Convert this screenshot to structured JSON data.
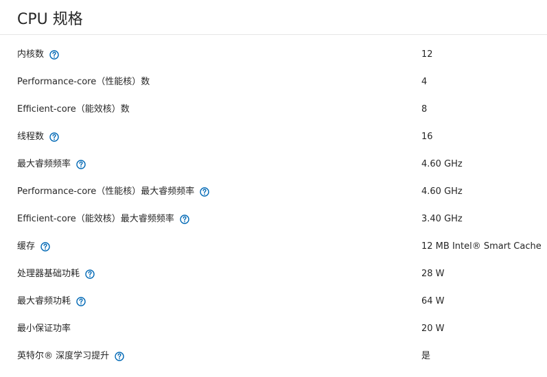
{
  "page": {
    "title": "CPU 规格"
  },
  "colors": {
    "text": "#262626",
    "divider": "#e5e5e5",
    "help_icon": "#0068b5"
  },
  "help_icon_name": "question-circle-icon",
  "specs": [
    {
      "label": "内核数",
      "value": "12",
      "has_help": true
    },
    {
      "label": "Performance-core（性能核）数",
      "value": "4",
      "has_help": false
    },
    {
      "label": "Efficient-core（能效核）数",
      "value": "8",
      "has_help": false
    },
    {
      "label": "线程数",
      "value": "16",
      "has_help": true
    },
    {
      "label": "最大睿频频率",
      "value": "4.60 GHz",
      "has_help": true
    },
    {
      "label": "Performance-core（性能核）最大睿频频率",
      "value": "4.60 GHz",
      "has_help": true
    },
    {
      "label": "Efficient-core（能效核）最大睿频频率",
      "value": "3.40 GHz",
      "has_help": true
    },
    {
      "label": "缓存",
      "value": "12 MB Intel® Smart Cache",
      "has_help": true
    },
    {
      "label": "处理器基础功耗",
      "value": "28 W",
      "has_help": true
    },
    {
      "label": "最大睿频功耗",
      "value": "64 W",
      "has_help": true
    },
    {
      "label": "最小保证功率",
      "value": "20 W",
      "has_help": false
    },
    {
      "label": "英特尔® 深度学习提升",
      "value": "是",
      "has_help": true
    }
  ]
}
